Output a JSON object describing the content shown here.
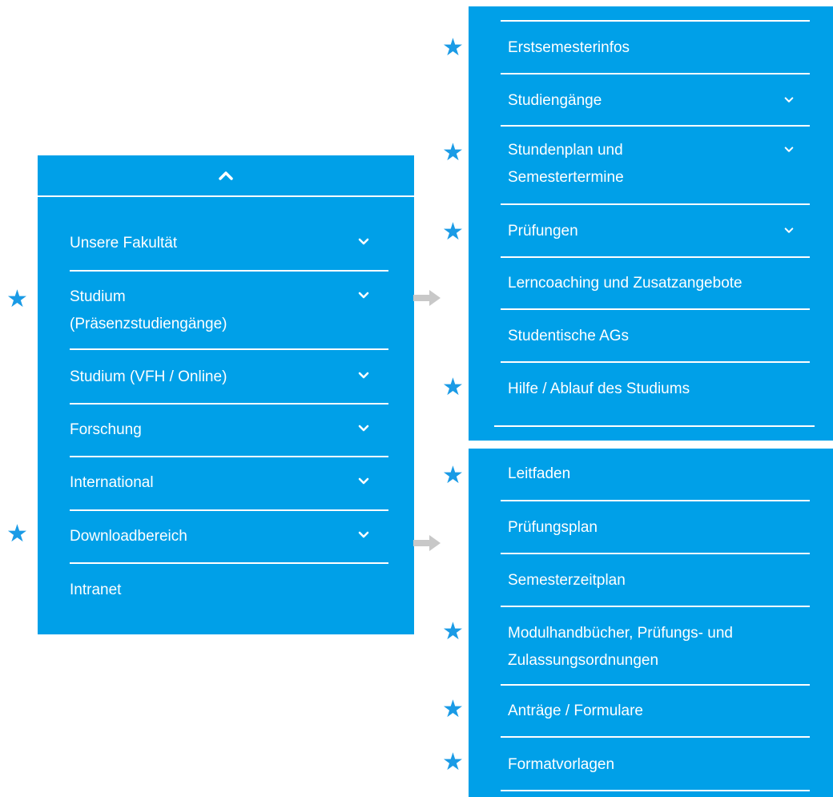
{
  "colors": {
    "panel": "#00a0e8",
    "text": "#ffffff",
    "star": "#1a9be6",
    "arrow": "#c8c8c8"
  },
  "icons": {
    "collapse": "chevron-up-icon",
    "expand": "chevron-down-icon",
    "marker": "star-icon",
    "link": "arrow-right-icon"
  },
  "left_menu": {
    "items": [
      {
        "label": "Unsere Fakultät",
        "has_submenu": true,
        "starred": false
      },
      {
        "label": "Studium",
        "label_line2": "(Präsenzstudiengänge)",
        "has_submenu": true,
        "starred": true
      },
      {
        "label": "Studium (VFH / Online)",
        "has_submenu": true,
        "starred": false
      },
      {
        "label": "Forschung",
        "has_submenu": true,
        "starred": false
      },
      {
        "label": "International",
        "has_submenu": true,
        "starred": false
      },
      {
        "label": "Downloadbereich",
        "has_submenu": true,
        "starred": true
      },
      {
        "label": "Intranet",
        "has_submenu": false,
        "starred": false
      }
    ]
  },
  "studium_submenu": {
    "items": [
      {
        "label": "Erstsemesterinfos",
        "has_submenu": false,
        "starred": true
      },
      {
        "label": "Studiengänge",
        "has_submenu": true,
        "starred": false
      },
      {
        "label": "Stundenplan und",
        "label_line2": "Semestertermine",
        "has_submenu": true,
        "starred": true
      },
      {
        "label": "Prüfungen",
        "has_submenu": true,
        "starred": true
      },
      {
        "label": "Lerncoaching und Zusatzangebote",
        "has_submenu": false,
        "starred": false
      },
      {
        "label": "Studentische AGs",
        "has_submenu": false,
        "starred": false
      },
      {
        "label": "Hilfe / Ablauf des Studiums",
        "has_submenu": false,
        "starred": true
      }
    ]
  },
  "download_submenu": {
    "items": [
      {
        "label": "Leitfaden",
        "starred": true
      },
      {
        "label": "Prüfungsplan",
        "starred": false
      },
      {
        "label": "Semesterzeitplan",
        "starred": false
      },
      {
        "label": "Modulhandbücher, Prüfungs- und",
        "label_line2": "Zulassungsordnungen",
        "starred": true
      },
      {
        "label": "Anträge / Formulare",
        "starred": true
      },
      {
        "label": "Formatvorlagen",
        "starred": true
      }
    ]
  }
}
